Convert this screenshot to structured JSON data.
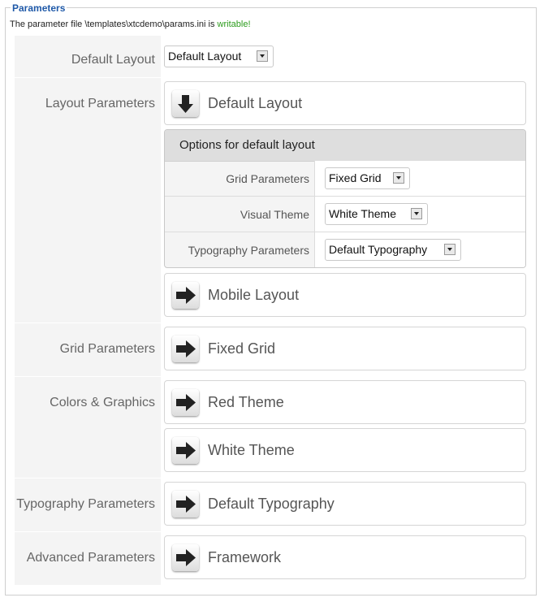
{
  "fieldset": {
    "legend": "Parameters",
    "status_prefix": "The parameter file \\templates\\xtcdemo\\params.ini is ",
    "status_writable": "writable!"
  },
  "rows": {
    "default_layout": {
      "label": "Default Layout",
      "select": "Default Layout"
    },
    "layout_parameters": {
      "label": "Layout Parameters"
    },
    "grid_parameters": {
      "label": "Grid Parameters"
    },
    "colors_graphics": {
      "label": "Colors & Graphics"
    },
    "typography_parameters": {
      "label": "Typography Parameters"
    },
    "advanced_parameters": {
      "label": "Advanced Parameters"
    }
  },
  "panels": {
    "default_layout": {
      "title": "Default Layout",
      "icon": "arrow-down-icon",
      "expanded": true
    },
    "mobile_layout": {
      "title": "Mobile Layout",
      "icon": "arrow-right-icon"
    },
    "fixed_grid": {
      "title": "Fixed Grid",
      "icon": "arrow-right-icon"
    },
    "red_theme": {
      "title": "Red Theme",
      "icon": "arrow-right-icon"
    },
    "white_theme": {
      "title": "White Theme",
      "icon": "arrow-right-icon"
    },
    "default_typography": {
      "title": "Default Typography",
      "icon": "arrow-right-icon"
    },
    "framework": {
      "title": "Framework",
      "icon": "arrow-right-icon"
    }
  },
  "options": {
    "header": "Options for default layout",
    "rows": [
      {
        "label": "Grid Parameters",
        "value": "Fixed Grid"
      },
      {
        "label": "Visual Theme",
        "value": "White Theme"
      },
      {
        "label": "Typography Parameters",
        "value": "Default Typography"
      }
    ]
  },
  "colors": {
    "legend": "#1f59a8",
    "writable": "#2a9b1a",
    "label_column": "#f4f4f4",
    "options_header": "#dedede"
  }
}
